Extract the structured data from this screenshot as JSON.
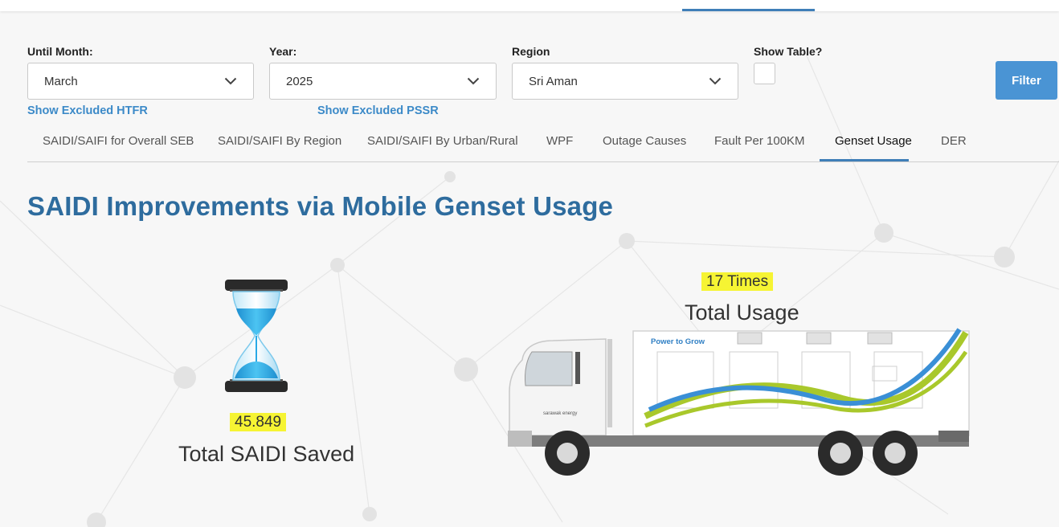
{
  "filters": {
    "until_month": {
      "label": "Until Month:",
      "value": "March"
    },
    "year": {
      "label": "Year:",
      "value": "2025"
    },
    "region": {
      "label": "Region",
      "value": "Sri Aman"
    },
    "show_table": {
      "label": "Show Table?",
      "checked": false
    },
    "filter_button": "Filter"
  },
  "links": {
    "excluded_htfr": "Show Excluded HTFR",
    "excluded_pssr": "Show Excluded PSSR"
  },
  "tabs": [
    {
      "label": "SAIDI/SAIFI for Overall SEB",
      "active": false
    },
    {
      "label": "SAIDI/SAIFI By Region",
      "active": false
    },
    {
      "label": "SAIDI/SAIFI By Urban/Rural",
      "active": false
    },
    {
      "label": "WPF",
      "active": false
    },
    {
      "label": "Outage Causes",
      "active": false
    },
    {
      "label": "Fault Per 100KM",
      "active": false
    },
    {
      "label": "Genset Usage",
      "active": true
    },
    {
      "label": "DER",
      "active": false
    }
  ],
  "page_title": "SAIDI Improvements via Mobile Genset Usage",
  "metrics": {
    "saidi_saved": {
      "value": "45.849",
      "label": "Total SAIDI Saved"
    },
    "usage": {
      "value": "17 Times",
      "label": "Total Usage"
    }
  },
  "truck": {
    "slogan": "Power to Grow",
    "brand": "sarawak energy"
  },
  "colors": {
    "accent": "#3f7fb8",
    "title": "#2e6c9e",
    "link": "#3c8ac8",
    "button": "#4a94d4",
    "highlight": "#f6f433",
    "hourglass_sand": "#29a9e6",
    "swoosh_green": "#a9c82b",
    "swoosh_blue": "#3a8fd6"
  }
}
